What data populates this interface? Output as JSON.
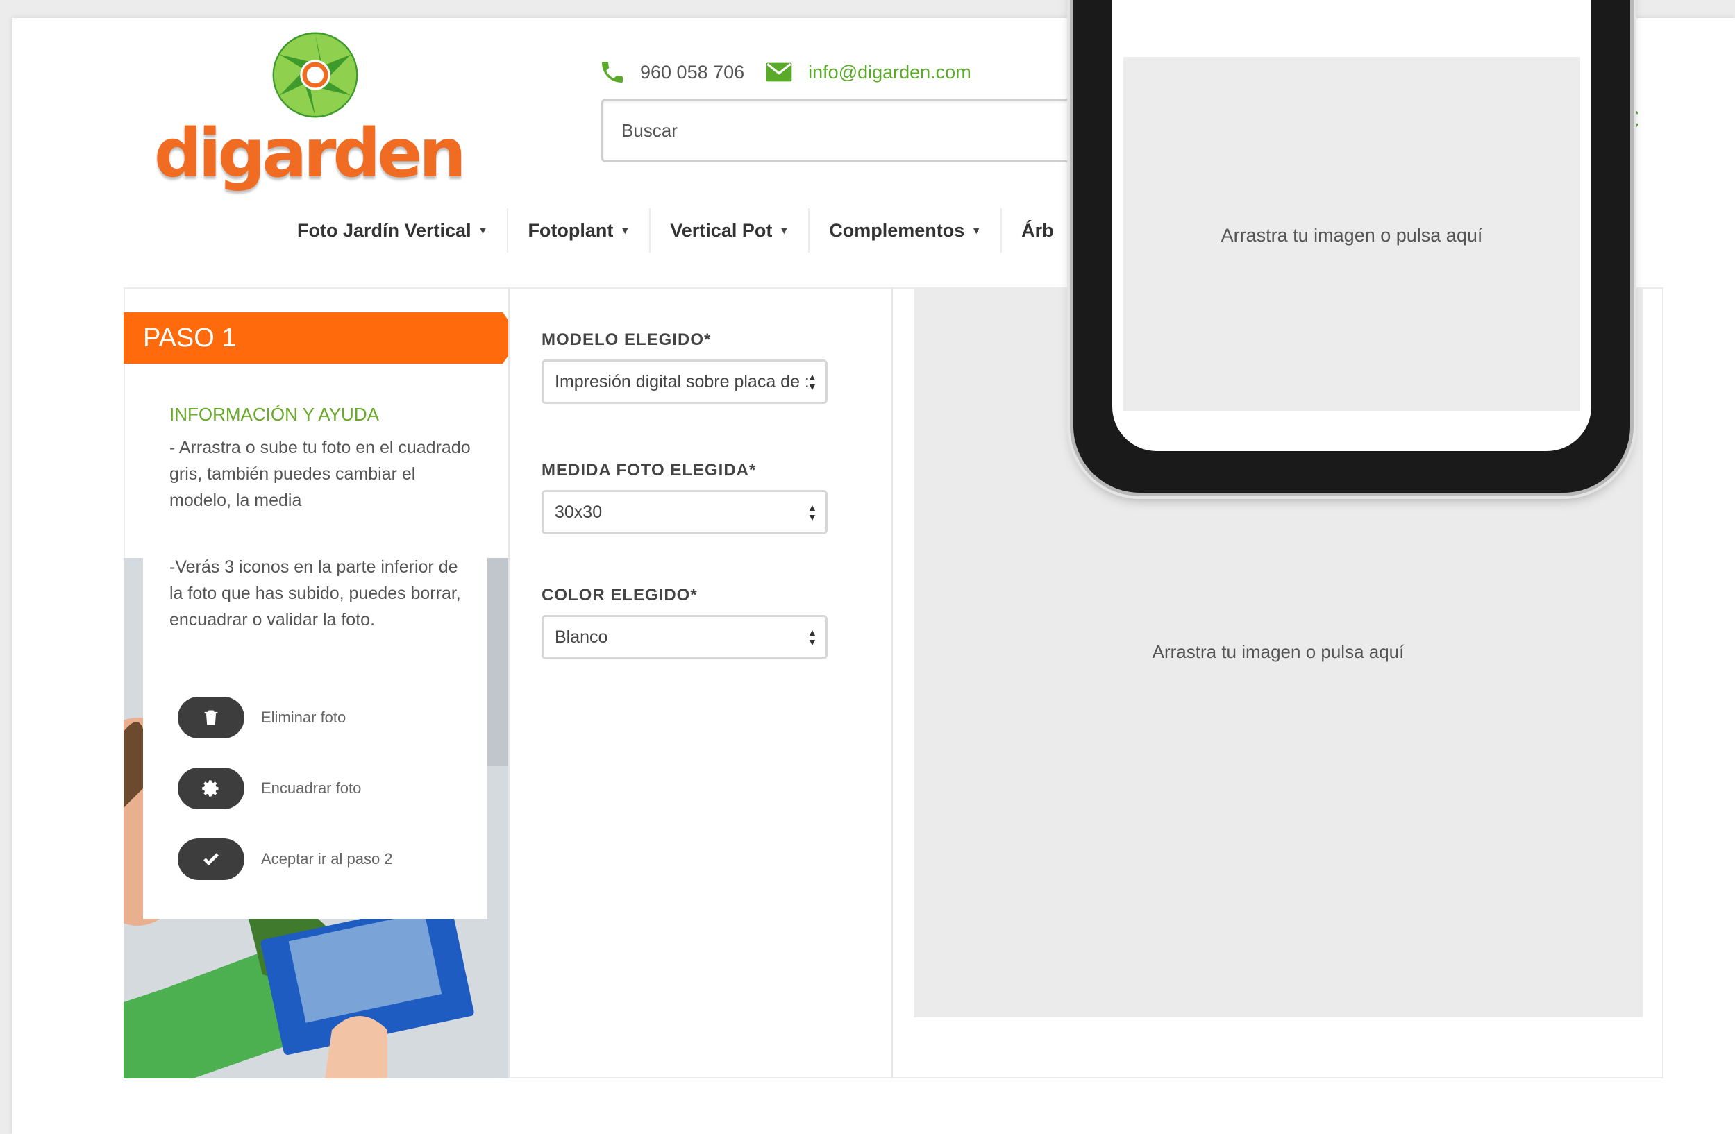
{
  "header": {
    "logo_text": "digarden",
    "phone": "960 058 706",
    "email": "info@digarden.com",
    "search_placeholder": "Buscar"
  },
  "nav": {
    "items": [
      {
        "label": "Foto Jardín Vertical"
      },
      {
        "label": "Fotoplant"
      },
      {
        "label": "Vertical Pot"
      },
      {
        "label": "Complementos"
      },
      {
        "label": "Árb"
      }
    ]
  },
  "step": {
    "label": "PASO 1",
    "help_title": "INFORMACIÓN Y AYUDA",
    "help_text_1": "- Arrastra o sube tu foto en el cuadrado gris, también puedes cambiar el modelo, la media",
    "help_text_2": "-Verás 3 iconos en la parte inferior de la foto que has subido, puedes borrar, encuadrar o validar la foto.",
    "icons": [
      {
        "label": "Eliminar foto",
        "icon": "trash-icon"
      },
      {
        "label": "Encuadrar foto",
        "icon": "gear-icon"
      },
      {
        "label": "Aceptar ir al paso 2",
        "icon": "check-icon"
      }
    ]
  },
  "form": {
    "model_label": "MODELO ELEGIDO*",
    "model_value": "Impresión digital sobre placa de :",
    "size_label": "MEDIDA FOTO ELEGIDA*",
    "size_value": "30x30",
    "color_label": "COLOR ELEGIDO*",
    "color_value": "Blanco"
  },
  "preview": {
    "drop_text": "Arrastra tu imagen o pulsa aquí"
  },
  "phone_overlay": {
    "drop_text": "Arrastra tu imagen o pulsa aquí"
  },
  "colors": {
    "brand_green": "#5aaa2a",
    "brand_orange": "#ff6a0d",
    "dark_button": "#3d3d3d"
  }
}
